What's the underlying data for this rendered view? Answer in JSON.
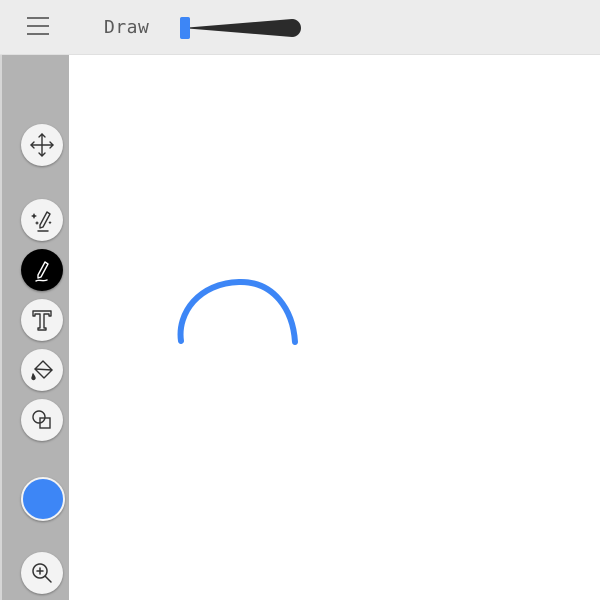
{
  "header": {
    "menu_icon": "hamburger-menu-icon",
    "mode_label": "Draw",
    "brush_size_level": 0.03
  },
  "toolbar": {
    "tools": [
      {
        "name": "move",
        "icon": "move-arrows-icon",
        "active": false
      },
      {
        "name": "magic-pen",
        "icon": "magic-pen-icon",
        "active": false
      },
      {
        "name": "pen",
        "icon": "pen-icon",
        "active": true
      },
      {
        "name": "text",
        "icon": "text-icon",
        "active": false
      },
      {
        "name": "fill",
        "icon": "paint-bucket-icon",
        "active": false
      },
      {
        "name": "shapes",
        "icon": "shapes-icon",
        "active": false
      },
      {
        "name": "zoom",
        "icon": "zoom-in-icon",
        "active": false
      }
    ],
    "current_color": "#3d86f6"
  },
  "colors": {
    "accent": "#3d86f6",
    "toolbar_bg": "#b3b3b3",
    "topbar_bg": "#ececec",
    "active_tool_bg": "#000000"
  },
  "canvas": {
    "stroke_color": "#3d86f6"
  }
}
